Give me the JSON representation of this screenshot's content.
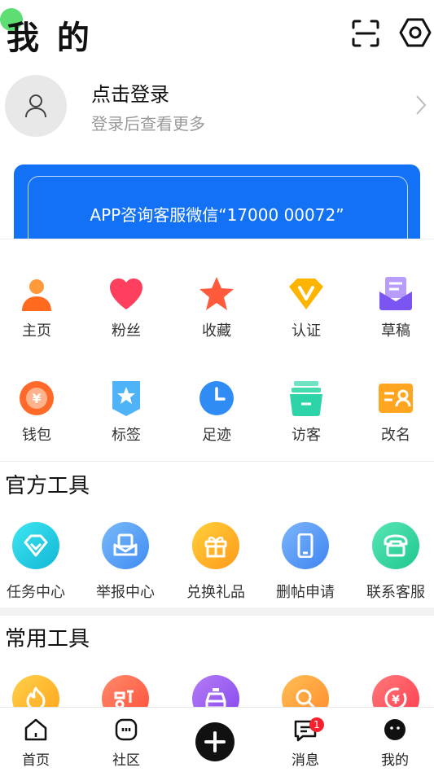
{
  "header": {
    "title": "我 的"
  },
  "profile": {
    "login_title": "点击登录",
    "login_subtitle": "登录后查看更多"
  },
  "banner": {
    "text": "APP咨询客服微信“17000 00072”"
  },
  "grid": {
    "row1": [
      {
        "label": "主页",
        "icon": "person-icon",
        "color": "#ff7a2e"
      },
      {
        "label": "粉丝",
        "icon": "heart-icon",
        "color": "#ff3f5e"
      },
      {
        "label": "收藏",
        "icon": "star-icon",
        "color": "#ff5a3c"
      },
      {
        "label": "认证",
        "icon": "verified-v-icon",
        "color": "#ffb400"
      },
      {
        "label": "草稿",
        "icon": "draft-icon",
        "color": "#8a63f5"
      }
    ],
    "row2": [
      {
        "label": "钱包",
        "icon": "wallet-coin-icon",
        "color": "#ff6a2a"
      },
      {
        "label": "标签",
        "icon": "tag-badge-icon",
        "color": "#3da9f5"
      },
      {
        "label": "足迹",
        "icon": "clock-icon",
        "color": "#2f8cf5"
      },
      {
        "label": "访客",
        "icon": "visitor-icon",
        "color": "#2dd4a7"
      },
      {
        "label": "改名",
        "icon": "rename-card-icon",
        "color": "#ffa51f"
      }
    ]
  },
  "official_tools": {
    "title": "官方工具",
    "items": [
      {
        "label": "任务中心",
        "icon": "task-diamond-icon",
        "color": "#18c6dc"
      },
      {
        "label": "举报中心",
        "icon": "report-icon",
        "color": "#4a9cf5"
      },
      {
        "label": "兑换礼品",
        "icon": "gift-icon",
        "color": "#ffa81f"
      },
      {
        "label": "删帖申请",
        "icon": "phone-device-icon",
        "color": "#4a8ef5"
      },
      {
        "label": "联系客服",
        "icon": "telephone-icon",
        "color": "#2ed1a0"
      }
    ]
  },
  "common_tools": {
    "title": "常用工具",
    "items": [
      {
        "icon": "fire-icon",
        "color": "#ffb01f"
      },
      {
        "icon": "car-icon",
        "color": "#ff5f4a"
      },
      {
        "icon": "taxi-icon",
        "color": "#9b5cf0"
      },
      {
        "icon": "search-pin-icon",
        "color": "#ff9d2e"
      },
      {
        "icon": "yuan-cycle-icon",
        "color": "#ff4d5b"
      }
    ]
  },
  "bottom_nav": {
    "items": [
      {
        "label": "首页"
      },
      {
        "label": "社区"
      },
      {
        "label": ""
      },
      {
        "label": "消息",
        "badge": "1"
      },
      {
        "label": "我的"
      }
    ]
  }
}
